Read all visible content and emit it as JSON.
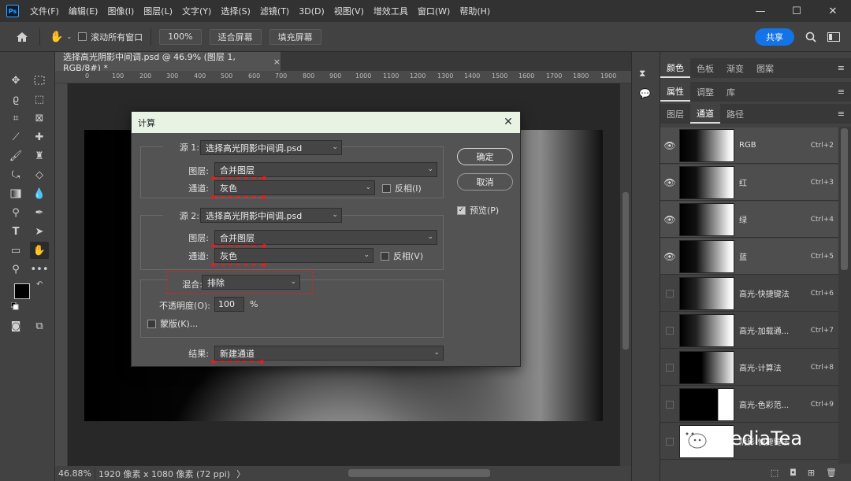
{
  "menubar": {
    "app_icon": "Ps",
    "items": [
      "文件(F)",
      "编辑(E)",
      "图像(I)",
      "图层(L)",
      "文字(Y)",
      "选择(S)",
      "滤镜(T)",
      "3D(D)",
      "视图(V)",
      "增效工具",
      "窗口(W)",
      "帮助(H)"
    ]
  },
  "window": {
    "minimize": "—",
    "maximize": "☐",
    "close": "✕"
  },
  "options": {
    "scroll_all": "滚动所有窗口",
    "zoom": "100%",
    "fit_screen": "适合屏幕",
    "fill_screen": "填充屏幕",
    "share": "共享"
  },
  "doc": {
    "tab_title": "选择高光阴影中间调.psd @ 46.9% (图层 1, RGB/8#) *",
    "close": "×"
  },
  "ruler": [
    "0",
    "100",
    "200",
    "300",
    "400",
    "500",
    "600",
    "700",
    "800",
    "900",
    "1000",
    "1100",
    "1200",
    "1300",
    "1400",
    "1500",
    "1600",
    "1700",
    "1800",
    "1900"
  ],
  "status": {
    "zoom": "46.88%",
    "info": "1920 像素 x 1080 像素 (72 ppi)",
    "arrow": "〉"
  },
  "panels": {
    "row1": [
      "颜色",
      "色板",
      "渐变",
      "图案"
    ],
    "row2": [
      "属性",
      "调整",
      "库"
    ],
    "row3": [
      "图层",
      "通道",
      "路径"
    ],
    "active1": "颜色",
    "active2": "属性",
    "active3": "通道"
  },
  "channels": [
    {
      "name": "RGB",
      "shortcut": "Ctrl+2",
      "visible": true
    },
    {
      "name": "红",
      "shortcut": "Ctrl+3",
      "visible": true
    },
    {
      "name": "绿",
      "shortcut": "Ctrl+4",
      "visible": true
    },
    {
      "name": "蓝",
      "shortcut": "Ctrl+5",
      "visible": true
    },
    {
      "name": "高光-快捷键法",
      "shortcut": "Ctrl+6",
      "visible": false
    },
    {
      "name": "高光-加载通...",
      "shortcut": "Ctrl+7",
      "visible": false
    },
    {
      "name": "高光-计算法",
      "shortcut": "Ctrl+8",
      "visible": false
    },
    {
      "name": "高光-色彩范...",
      "shortcut": "Ctrl+9",
      "visible": false
    },
    {
      "name": "阴影-快捷键法",
      "shortcut": "",
      "visible": false
    }
  ],
  "dialog": {
    "title": "计算",
    "close": "✕",
    "source1": {
      "label": "源 1:",
      "file": "选择高光阴影中间调.psd",
      "layer_label": "图层:",
      "layer": "合并图层",
      "channel_label": "通道:",
      "channel": "灰色",
      "invert": "反相(I)"
    },
    "source2": {
      "label": "源 2:",
      "file": "选择高光阴影中间调.psd",
      "layer_label": "图层:",
      "layer": "合并图层",
      "channel_label": "通道:",
      "channel": "灰色",
      "invert": "反相(V)"
    },
    "blend": {
      "label": "混合:",
      "mode": "排除",
      "opacity_label": "不透明度(O):",
      "opacity": "100",
      "percent": "%",
      "mask": "蒙版(K)..."
    },
    "result": {
      "label": "结果:",
      "value": "新建通道"
    },
    "ok": "确定",
    "cancel": "取消",
    "preview": "预览(P)",
    "preview_checked": true
  },
  "watermark": "MediaTea"
}
